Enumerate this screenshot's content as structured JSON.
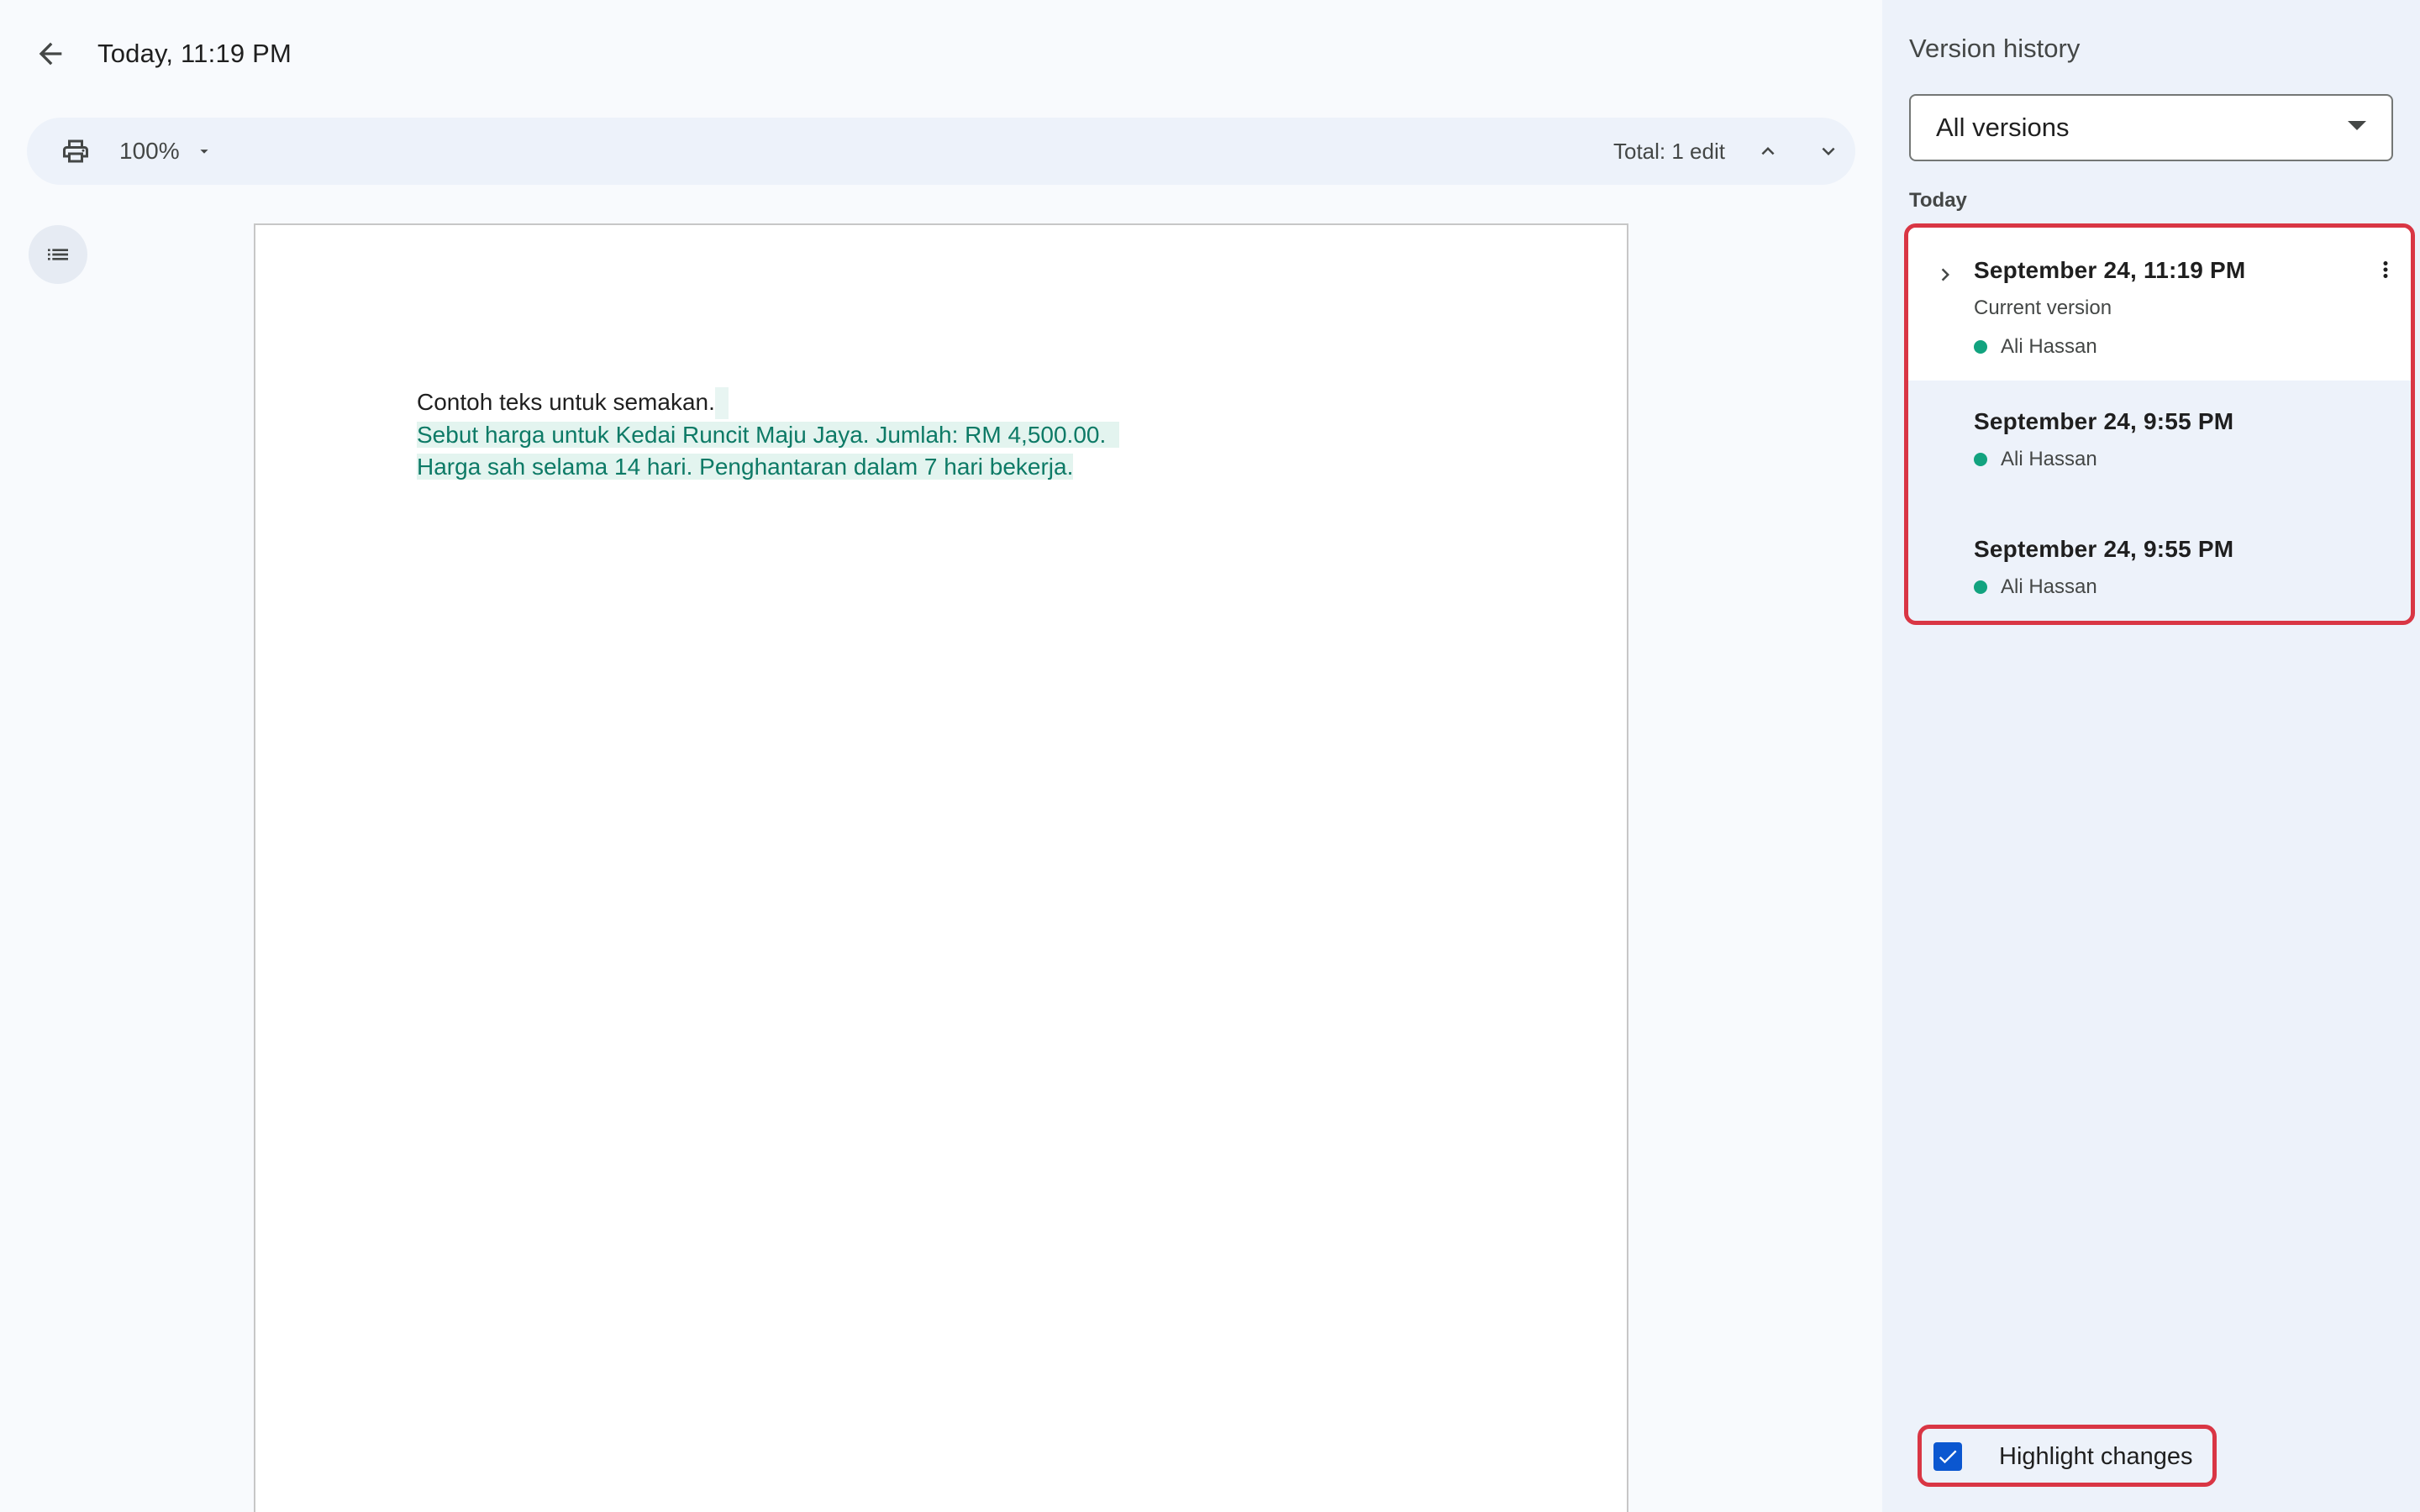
{
  "header": {
    "title": "Today, 11:19 PM"
  },
  "toolbar": {
    "zoom": "100%",
    "total_edits": "Total: 1 edit"
  },
  "document": {
    "lines": [
      "Contoh teks untuk semakan.",
      "Sebut harga untuk Kedai Runcit Maju Jaya. Jumlah: RM 4,500.00.",
      "Harga sah selama 14 hari. Penghantaran dalam 7 hari bekerja."
    ]
  },
  "sidebar": {
    "title": "Version history",
    "filter": "All versions",
    "group_label": "Today",
    "versions": [
      {
        "date": "September 24, 11:19 PM",
        "subtitle": "Current version",
        "author": "Ali Hassan"
      },
      {
        "date": "September 24, 9:55 PM",
        "author": "Ali Hassan"
      },
      {
        "date": "September 24, 9:55 PM",
        "author": "Ali Hassan"
      }
    ],
    "highlight_label": "Highlight changes"
  },
  "colors": {
    "accent": "#0b57d0",
    "added_text": "#0d7a66",
    "added_bg": "#e3f4ef",
    "author_dot": "#12a37f",
    "annotation_red": "#d93644"
  },
  "icons": {
    "back": "arrow-left-icon",
    "print": "printer-icon",
    "zoom_dropdown": "caret-down-icon",
    "prev_edit": "chevron-up-icon",
    "next_edit": "chevron-down-icon",
    "outline": "list-icon",
    "expand": "chevron-right-icon",
    "more": "more-vert-icon",
    "check": "check-icon"
  }
}
